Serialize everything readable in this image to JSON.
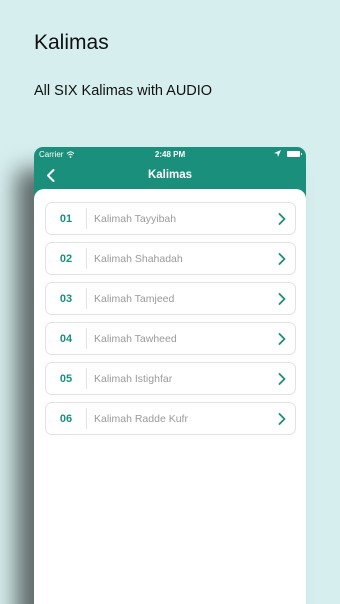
{
  "promo": {
    "title": "Kalimas",
    "subtitle": "All SIX Kalimas with AUDIO"
  },
  "status_bar": {
    "carrier": "Carrier",
    "time": "2:48 PM"
  },
  "nav": {
    "title": "Kalimas"
  },
  "kalimas": [
    {
      "number": "01",
      "name": "Kalimah Tayyibah"
    },
    {
      "number": "02",
      "name": "Kalimah Shahadah"
    },
    {
      "number": "03",
      "name": "Kalimah Tamjeed"
    },
    {
      "number": "04",
      "name": "Kalimah Tawheed"
    },
    {
      "number": "05",
      "name": "Kalimah Istighfar"
    },
    {
      "number": "06",
      "name": "Kalimah Radde Kufr"
    }
  ],
  "colors": {
    "accent": "#1a8f7b",
    "background": "#d6eeee"
  },
  "icons": {
    "back": "chevron-left-icon",
    "row": "chevron-right-icon",
    "wifi": "wifi-icon",
    "location": "location-arrow-icon",
    "battery": "battery-icon"
  }
}
